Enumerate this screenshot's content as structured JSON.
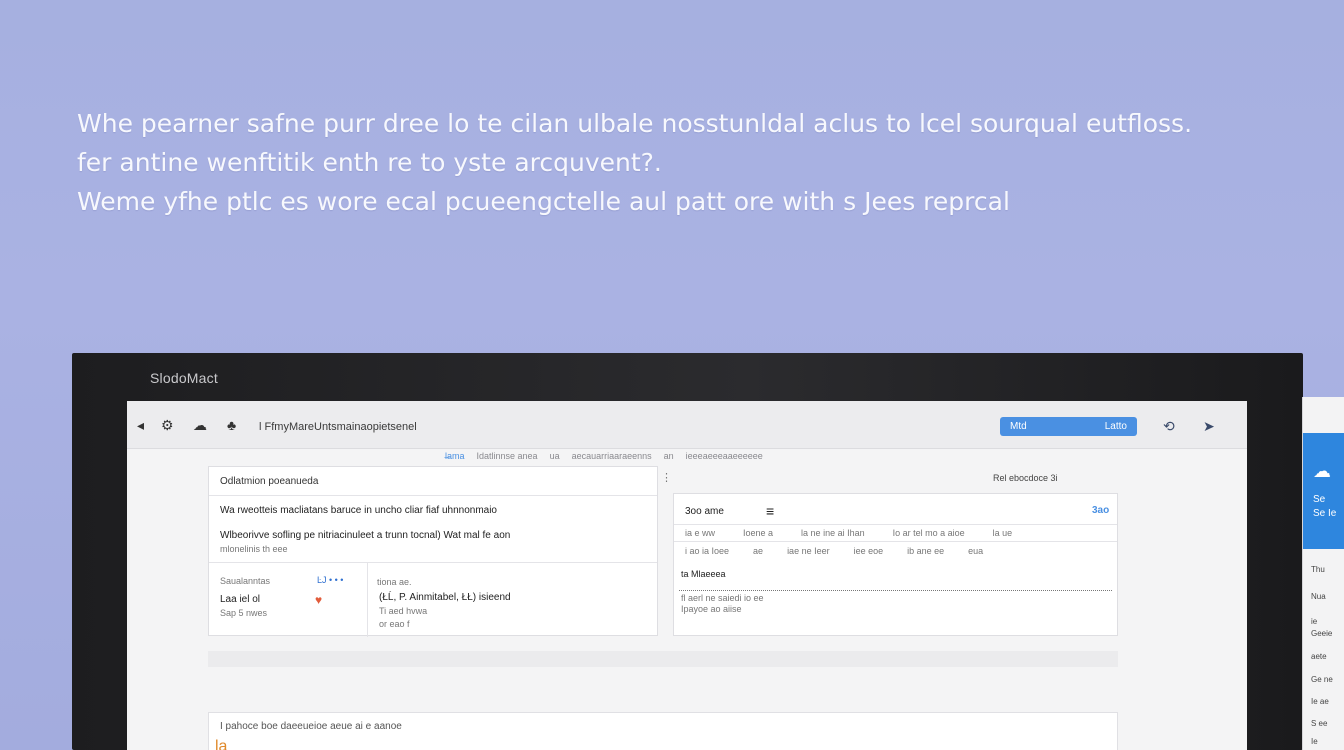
{
  "hero": {
    "line1": "Whe pearner safne purr dree lo te cilan ulbale nosstunldal aclus to lcel sourqual eutfloss.",
    "line2": "fer antine wenftitik enth re to yste arcquvent?.",
    "line3": "Weme yfhe ptlc es wore ecal pcueengctelle aul patt ore with s Jees reprcal"
  },
  "monitor": {
    "brand": "SlodoMact"
  },
  "topbar": {
    "url": "l   FfmyMareUntsmainaopietsenel",
    "button_left": "Mtd",
    "button_right": "Latto",
    "icon_sync": "⟲",
    "icon_send": "➤"
  },
  "subnav": [
    "l̶ama",
    "Idatlinnse anea",
    "ua",
    "aecauarriaaraeenns",
    "an",
    "ieeeaeeeaaeeeeee"
  ],
  "left_card": {
    "header": "Odlatmion  poeanueda",
    "line1": "Wa rweotteis macliatans baruce in uncho cliar fiaf uhnnonmaio",
    "line2": "Wlbeorivve sofling pe nitriacinuleet a trunn tocnal) Wat mal fe aon",
    "line3": "mlonelinis th eee",
    "row_a_label": "Saualanntas",
    "row_a_value": "Laa iel ol",
    "row_a_sub": "Sap 5 nwes",
    "row_b_tags": "ĿJ • • •",
    "row_c_title": "(ŁĹ, P.   Ainmitabel, ŁŁ) isieend",
    "row_c_sub1": "Ti aed hvwa",
    "row_c_sub2": "or eao f",
    "row_c_head": "tiona ae."
  },
  "right_card": {
    "top_label": "Rel ebocdoce  3i",
    "badge": "3ao",
    "head_left": "3oo ame",
    "head_icon": "≡",
    "cols": [
      "ia e ww",
      "Ioene a",
      "la ne ine ai Ihan",
      "Io ar  tel mo a aioe",
      "la ue"
    ],
    "row2": [
      "i ao   ia   Ioee",
      "ae",
      "iae ne  Ieer",
      "iee   eoe",
      "ib   ane ee",
      "eua"
    ],
    "section": "ta  Mlaeeea",
    "note1": "fl aerl ne saiedi io ee",
    "note2": "Ipayoe ao  aiise"
  },
  "bottom_card": {
    "text": "I pahoce boe daeeueioe aeue ai e aanoe",
    "tag": "la"
  },
  "side_panel": {
    "blue_text": [
      "Se",
      "Se Ie"
    ],
    "items": [
      "Thu",
      "Nua",
      "ie",
      "Geeie",
      "aete",
      "Ge ne",
      "Ie ae",
      "S ee",
      "Ie"
    ]
  },
  "colors": {
    "accent": "#4a90e2",
    "side_blue": "#2e86de"
  }
}
